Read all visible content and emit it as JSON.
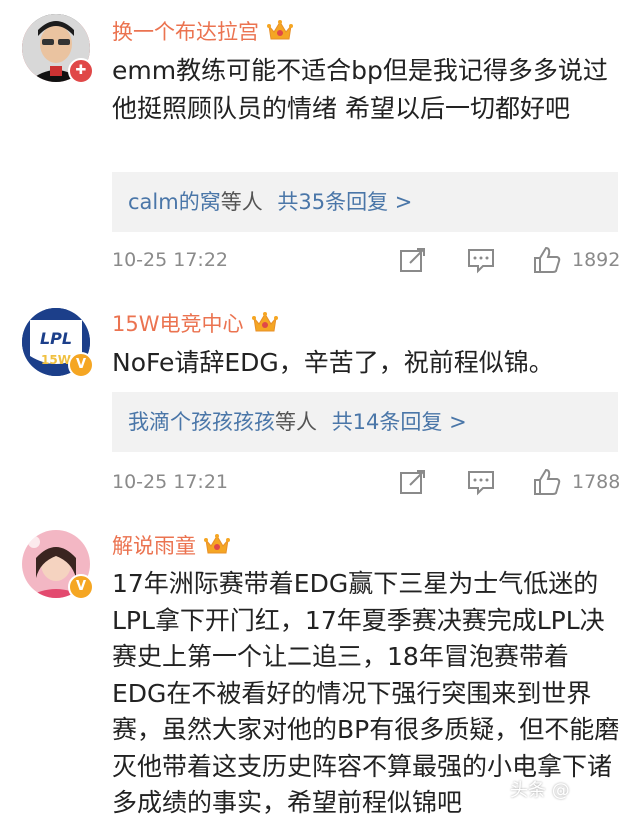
{
  "comments": [
    {
      "username": "换一个布达拉宫",
      "text": "emm教练可能不适合bp但是我记得多多说过他挺照顾队员的情绪  希望以后一切都好吧",
      "reply": {
        "users": "calm的窝",
        "suffix": "等人",
        "count": "共35条回复 >"
      },
      "time": "10-25 17:22",
      "likes": "1892"
    },
    {
      "username": "15W电竞中心",
      "text": "NoFe请辞EDG，辛苦了，祝前程似锦。",
      "reply": {
        "users": "我滴个孩孩孩孩",
        "suffix": "等人",
        "count": "共14条回复 >"
      },
      "time": "10-25 17:21",
      "likes": "1788"
    },
    {
      "username": "解说雨童",
      "text": "17年洲际赛带着EDG赢下三星为士气低迷的LPL拿下开门红，17年夏季赛决赛完成LPL决赛史上第一个让二追三，18年冒泡赛带着EDG在不被看好的情况下强行突围来到世界赛，虽然大家对他的BP有很多质疑，但不能磨灭他带着这支历史阵容不算最强的小电拿下诸多成绩的事实，希望前程似锦吧"
    }
  ],
  "avatar2_text": "LPL",
  "watermark": "头条 @"
}
